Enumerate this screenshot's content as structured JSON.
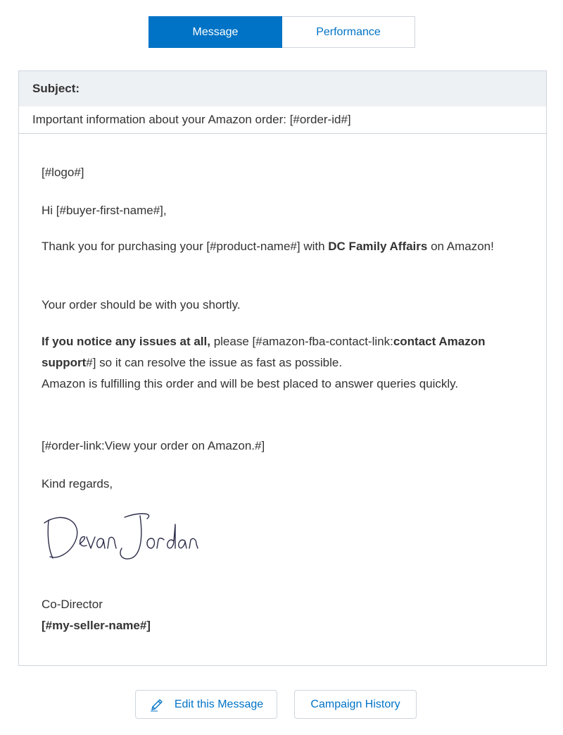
{
  "tabs": [
    {
      "label": "Message",
      "active": true
    },
    {
      "label": "Performance",
      "active": false
    }
  ],
  "subject": {
    "heading": "Subject:",
    "text": "Important information about your Amazon order: [#order-id#]"
  },
  "message": {
    "logo": "[#logo#]",
    "greeting": "Hi [#buyer-first-name#],",
    "thanks_before": "Thank you for purchasing your [#product-name#] with ",
    "thanks_bold": "DC Family Affairs",
    "thanks_after": " on Amazon!",
    "shortly": "Your order should be with you shortly.",
    "issues_bold": "If you notice any issues at all,",
    "issues_mid": " please [#amazon-fba-contact-link:",
    "issues_link_bold": "contact Amazon support",
    "issues_after": "#] so it can resolve the issue as fast as possible.",
    "issues_line2": "Amazon is fulfilling this order and will be best placed to answer queries quickly.",
    "order_link": "[#order-link:View your order on Amazon.#]",
    "regards": "Kind regards,",
    "signature_text": "Devan Jordan",
    "role": "Co-Director",
    "seller_name": "[#my-seller-name#]"
  },
  "buttons": {
    "edit": "Edit this Message",
    "history": "Campaign History"
  },
  "colors": {
    "accent": "#0073c6",
    "border": "#cfd6dd",
    "header_bg": "#eef1f4",
    "text": "#333333"
  },
  "icons": {
    "edit": "pencil-icon"
  }
}
